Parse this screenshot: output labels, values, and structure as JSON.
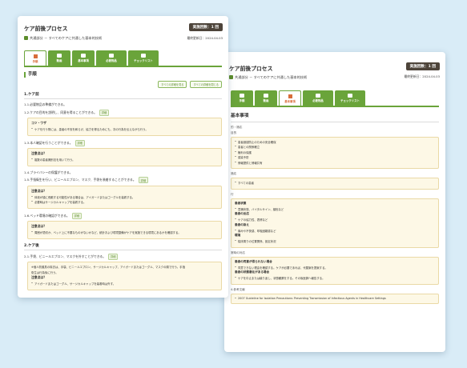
{
  "common": {
    "title": "ケア前後プロセス",
    "subtitle": "共通部分 － すべてのケアに共通した基本的技術",
    "count_badge": "実施回数：1 回",
    "updated": "最終更新日：2024.04.03",
    "count_badge_back": "実施回数：1 回",
    "updated_back": "最終更新日：2024.04.03"
  },
  "tabs": [
    {
      "label": "手順"
    },
    {
      "label": "動画"
    },
    {
      "label": "基本事項"
    },
    {
      "label": "必要物品"
    },
    {
      "label": "チェックリスト"
    }
  ],
  "front": {
    "heading": "手順",
    "expand_all": "すべての詳細を見る",
    "collapse_all": "すべての詳細を閉じる",
    "section1": "1.ケア前",
    "detail_label": "詳細",
    "l1_1": "1-1.必要物品の準備ができる。",
    "l1_2": "1-2.ケアの目的を説明し、同意を得ることができる。",
    "note1_title": "コツ・ワザ",
    "note1_b1": "ケアを行う際には、患者の不安を和らげ、協力を得るためにも、次の行為を伝えながら行う。",
    "l1_3": "1-3.本人確認を行うことができる。",
    "note2_title": "注意点は？",
    "note2_b1": "複数の患者識別法を用いて行う。",
    "l1_4": "1-4.プライバシーの保護ができる。",
    "l1_5": "1-5.手指衛生を行い、ビニールエプロン、マスク、手袋を装着することができる。",
    "note3_title": "注意点は？",
    "note3_b1": "体液が顔に飛散する可能性がある場合は、アイガードまたはゴーグルを装着する。",
    "note3_b2": "必要時はサージカルキャップを装着する。",
    "l1_6": "1-6.ベッド環境の確認ができる。",
    "note4_title": "注意点は？",
    "note4_b1": "周囲が適切か、ベッド上に不要なものがないかなど、統計および環境整備がケアを実施できる環境にあるかを確認する。",
    "section2": "2.ケア後",
    "l2_1": "2-1.手袋、ビニールエプロン、マスクを外すことができる。",
    "note5_p1": "※個人防護具の除去は、手袋、ビニールエプロン、サージカルキャップ、アイガードまたはゴーグル、マスクの順で行う。手指",
    "note5_p2": "衛生は行為後に行う。",
    "note5_title": "注意点は？",
    "note5_b1": "アイガードまたはゴーグル、サージカルキャップを装着時は外す。"
  },
  "back": {
    "heading": "基本事項",
    "label_purpose": "的・適応",
    "label_goal": "目的",
    "box1_items": [
      "患者誤認防止のための安全確保",
      "患者との関係確立",
      "権利の保護",
      "感染予防",
      "情報提供と情報共有"
    ],
    "label_indication": "適応",
    "box2_items": [
      "すべての患者"
    ],
    "label_points": "行",
    "box3_title1": "患者状態",
    "box3_item1": "意識状態、バイタルサイン、顔色など",
    "box3_title2": "患者の反応",
    "box3_item2": "ケアの協力性、表情など",
    "box3_title3": "患者の訴え",
    "box3_item3": "痛みや不快感、呼吸困難感など",
    "box3_title4": "環境",
    "box3_item4": "寝床周りの位置関係、設定状況",
    "label_abnormal": "常時の対応",
    "box4_title1": "患者の同意が得られない場合",
    "box4_item1": "同意できない理由を確認する。ケアが必要であれば、代替案を提案する。",
    "box4_title2": "患者の状態悪化がある場合",
    "box4_item2": "ケアを中止または繰り返し、状態観察をする。その後医師へ報告する。",
    "label_ref": "4.参考文献",
    "ref1": "2007 Guideline for Isolation Precautions: Preventing Transmission of Infectious Agents in Healthcare Settings"
  }
}
